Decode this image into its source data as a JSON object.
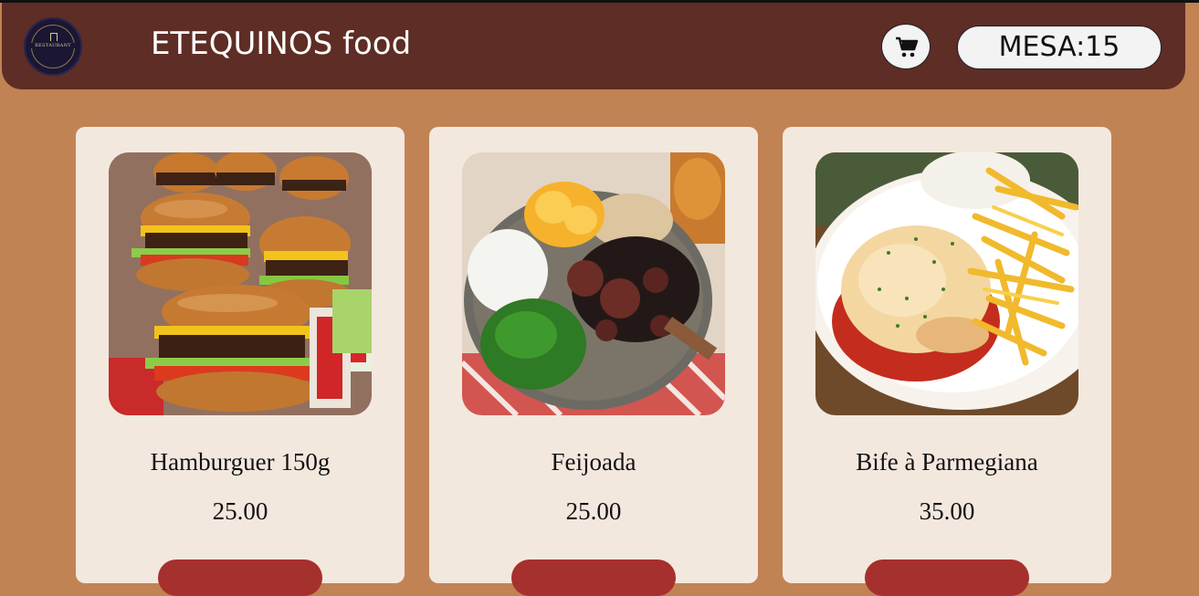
{
  "header": {
    "logo_text": "RESTAURANT",
    "brand": "ETEQUINOS food",
    "cart_icon": "shopping-cart-icon",
    "table_label": "MESA:15"
  },
  "products": [
    {
      "name": "Hamburguer 150g",
      "price": "25.00",
      "image": "hamburger-photo"
    },
    {
      "name": "Feijoada",
      "price": "25.00",
      "image": "feijoada-photo"
    },
    {
      "name": "Bife à Parmegiana",
      "price": "35.00",
      "image": "parmegiana-photo"
    }
  ],
  "colors": {
    "page_bg": "#c18354",
    "header_bg": "#5e2d25",
    "card_bg": "#f3e8de",
    "button": "#a6302d"
  }
}
